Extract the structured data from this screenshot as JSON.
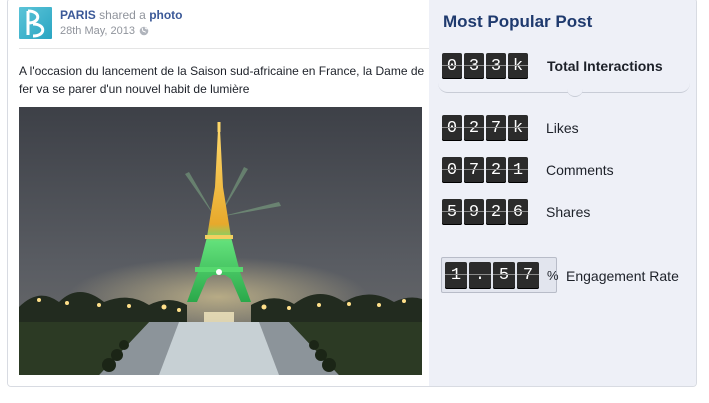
{
  "post": {
    "author": "PARIS",
    "action": "shared a",
    "object": "photo",
    "date": "28th May, 2013",
    "caption": "A l'occasion du lancement de la Saison sud-africaine en France, la Dame de fer va se parer d'un nouvel habit de lumière",
    "photo_icon": "eiffel-tower-night-photo"
  },
  "panel": {
    "title": "Most Popular Post",
    "total": {
      "digits": [
        "0",
        "3",
        "3",
        "k"
      ],
      "label": "Total Interactions"
    },
    "likes": {
      "digits": [
        "0",
        "2",
        "7",
        "k"
      ],
      "label": "Likes"
    },
    "comments": {
      "digits": [
        "0",
        "7",
        "2",
        "1"
      ],
      "label": "Comments"
    },
    "shares": {
      "digits": [
        "5",
        "9",
        "2",
        "6"
      ],
      "label": "Shares"
    },
    "engagement": {
      "digits": [
        "1",
        ".",
        "5",
        "7"
      ],
      "suffix": "%",
      "label": "Engagement Rate"
    }
  },
  "colors": {
    "title": "#1f3a6e",
    "link": "#3b5998",
    "panel_bg": "#eef0f7",
    "digit_bg": "#2b2b2b"
  }
}
